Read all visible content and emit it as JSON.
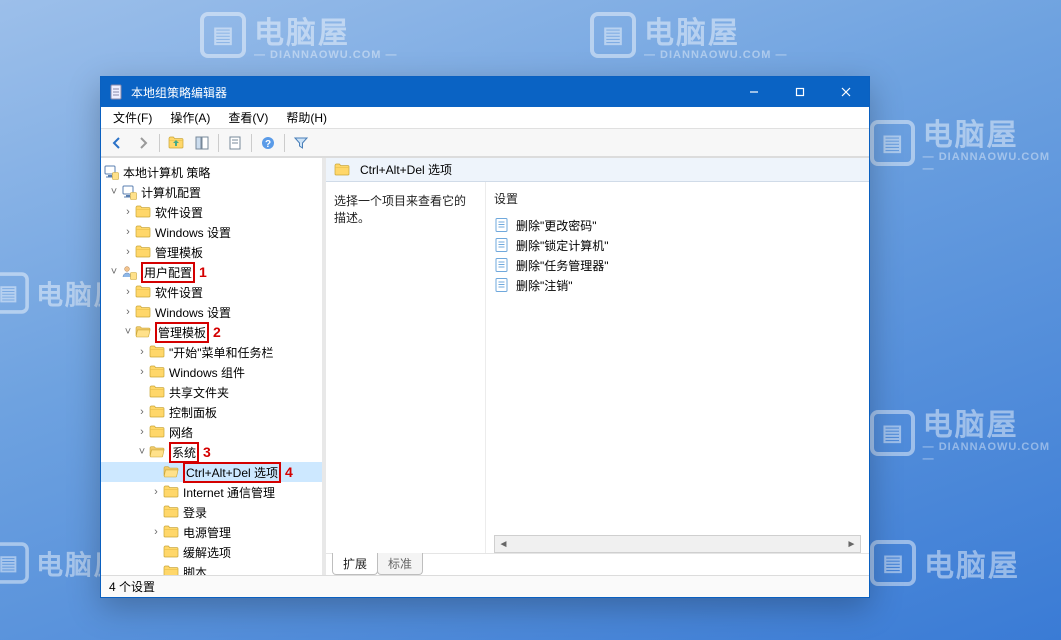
{
  "watermark": {
    "text": "电脑屋",
    "sub": "— DIANNAOWU.COM —",
    "iconGlyph": "▤"
  },
  "window": {
    "title": "本地组策略编辑器",
    "menu": {
      "file": "文件(F)",
      "action": "操作(A)",
      "view": "查看(V)",
      "help": "帮助(H)"
    },
    "status": "4 个设置"
  },
  "tree": {
    "root": "本地计算机 策略",
    "computerConfig": "计算机配置",
    "cc": {
      "software": "软件设置",
      "windows": "Windows 设置",
      "adminTemplates": "管理模板"
    },
    "userConfig": "用户配置",
    "uc": {
      "software": "软件设置",
      "windows": "Windows 设置",
      "adminTemplates": "管理模板"
    },
    "at": {
      "startMenu": "\"开始\"菜单和任务栏",
      "winComponents": "Windows 组件",
      "sharedFolders": "共享文件夹",
      "controlPanel": "控制面板",
      "network": "网络",
      "system": "系统",
      "ctrlAltDel": "Ctrl+Alt+Del 选项",
      "internetComm": "Internet 通信管理",
      "logon": "登录",
      "power": "电源管理",
      "mitigation": "缓解选项",
      "scripts": "脚本"
    },
    "annotations": {
      "n1": "1",
      "n2": "2",
      "n3": "3",
      "n4": "4"
    }
  },
  "right": {
    "heading": "Ctrl+Alt+Del 选项",
    "descHint": "选择一个项目来查看它的描述。",
    "settingsHdr": "设置",
    "items": {
      "0": "删除\"更改密码\"",
      "1": "删除\"锁定计算机\"",
      "2": "删除\"任务管理器\"",
      "3": "删除\"注销\""
    },
    "tabs": {
      "ext": "扩展",
      "std": "标准"
    }
  }
}
